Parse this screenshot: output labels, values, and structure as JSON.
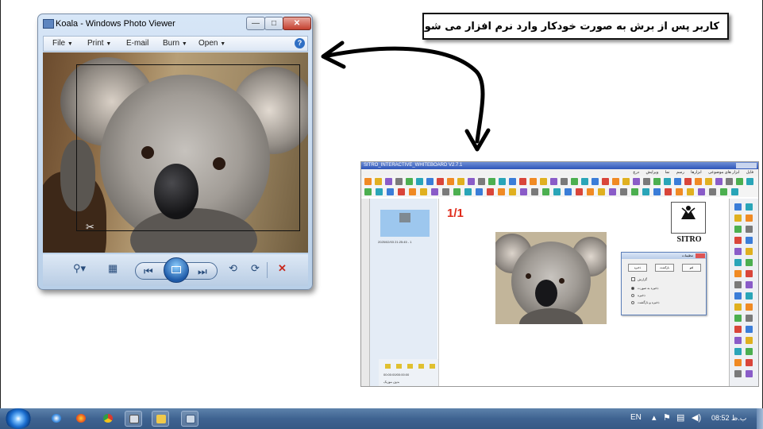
{
  "annotation": {
    "text": "کاربر پس از برش به صورت خودکار وارد نرم افزار می شود."
  },
  "photo_viewer": {
    "title": "Koala - Windows Photo Viewer",
    "menu": [
      {
        "label": "File",
        "has_dropdown": true
      },
      {
        "label": "Print",
        "has_dropdown": true
      },
      {
        "label": "E-mail",
        "has_dropdown": false
      },
      {
        "label": "Burn",
        "has_dropdown": true
      },
      {
        "label": "Open",
        "has_dropdown": true
      }
    ],
    "help_glyph": "?",
    "controls": [
      "zoom-icon",
      "fit-icon",
      "previous-icon",
      "slideshow-icon",
      "next-icon",
      "rotate-left-icon",
      "rotate-right-icon",
      "delete-icon"
    ]
  },
  "whiteboard": {
    "title": "SITRO_INTERACTIVE_WHITEBOARD V2.7.1",
    "menu": [
      "فایل",
      "ابزار های موضوعی",
      "ابزارها",
      "رسم",
      "نما",
      "ویرایش",
      "درج"
    ],
    "page_indicator": "1/1",
    "thumbnail_caption": "2025/02/03 21:25:45 - 1",
    "nav_time": "00:00:00/00:00:00",
    "nav_label": "بدون موزیک",
    "logo_text": "SITRO",
    "dialog": {
      "title": "تنظیمات",
      "buttons": [
        "ذخیره",
        "بازگشت",
        "لغو"
      ],
      "checkbox_label": "گزارش",
      "options": [
        "ذخیره به صورت",
        "ذخیره",
        "ذخیره و بازگشت"
      ]
    }
  },
  "taskbar": {
    "language": "EN",
    "clock": "08:52 ب.ظ",
    "pinned": [
      "windows-media-player-icon",
      "firefox-icon",
      "chrome-icon",
      "calculator-icon",
      "explorer-icon",
      "photo-viewer-icon"
    ]
  },
  "colors": {
    "accent_red": "#e02a1a",
    "taskbar": "#3f6391",
    "titlebar_blue": "#2e55b8"
  }
}
